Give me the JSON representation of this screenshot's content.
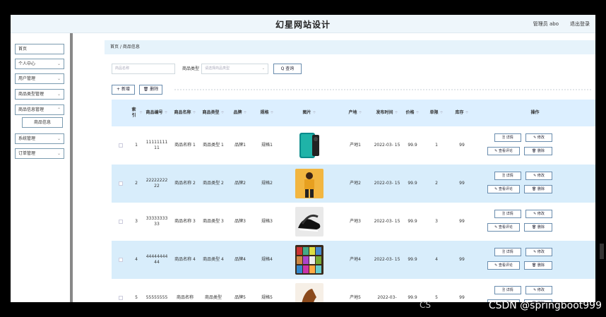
{
  "header": {
    "title": "幻星网站设计",
    "admin": "管理员 abo",
    "logout": "退出登录"
  },
  "sidebar": {
    "items": [
      {
        "label": "首页",
        "expandable": false
      },
      {
        "label": "个人中心",
        "expandable": true
      },
      {
        "label": "用户管理",
        "expandable": true
      },
      {
        "label": "商品类型管理",
        "expandable": true
      },
      {
        "label": "商品信息管理",
        "expandable": true
      },
      {
        "label": "商品信息",
        "expandable": false,
        "sub": true
      },
      {
        "label": "系统管理",
        "expandable": true
      },
      {
        "label": "订单管理",
        "expandable": true
      }
    ]
  },
  "breadcrumb": {
    "home": "首页",
    "sep": "/",
    "current": "商品信息"
  },
  "search": {
    "name_placeholder": "商品名称",
    "type_label": "商品类型",
    "type_placeholder": "请选择商品类型",
    "query_label": "Q 查询"
  },
  "actions": {
    "add_label": "+ 新增",
    "delete_label": "🗑 删除"
  },
  "table": {
    "headers": [
      "索引",
      "商品编号",
      "商品名称",
      "商品类型",
      "品牌",
      "规格",
      "图片",
      "产地",
      "发布时间",
      "价格",
      "单限",
      "库存",
      "操作"
    ],
    "rows": [
      {
        "idx": "1",
        "code": "11111111 11",
        "name": "商品名称 1",
        "type": "商品类型 1",
        "brand": "品牌1",
        "spec": "规格1",
        "origin": "产地1",
        "date": "2022-03- 15",
        "price": "99.9",
        "limit": "1",
        "stock": "99",
        "image": "phone"
      },
      {
        "idx": "2",
        "code": "22222222 22",
        "name": "商品名称 2",
        "type": "商品类型 2",
        "brand": "品牌2",
        "spec": "规格2",
        "origin": "产地2",
        "date": "2022-03- 15",
        "price": "99.9",
        "limit": "2",
        "stock": "99",
        "image": "fashion"
      },
      {
        "idx": "3",
        "code": "33333333 33",
        "name": "商品名称 3",
        "type": "商品类型 3",
        "brand": "品牌3",
        "spec": "规格3",
        "origin": "产地3",
        "date": "2022-03- 15",
        "price": "99.9",
        "limit": "3",
        "stock": "99",
        "image": "shoes"
      },
      {
        "idx": "4",
        "code": "44444444 44",
        "name": "商品名称 4",
        "type": "商品类型 4",
        "brand": "品牌4",
        "spec": "规格4",
        "origin": "产地4",
        "date": "2022-03- 15",
        "price": "99.9",
        "limit": "4",
        "stock": "99",
        "image": "books"
      },
      {
        "idx": "5",
        "code": "55555555",
        "name": "商品名称",
        "type": "商品类型",
        "brand": "品牌5",
        "spec": "规格5",
        "origin": "产地5",
        "date": "2022-03-",
        "price": "99.9",
        "limit": "5",
        "stock": "99",
        "image": "boots"
      }
    ],
    "op_labels": {
      "detail": "详情",
      "edit": "修改",
      "review": "查看评论",
      "delete": "删除"
    }
  },
  "watermark": "CSDN @springboot999",
  "cs_mark": "CS",
  "colors": {
    "accent": "#dcefff",
    "row_alt": "#d8edfb",
    "border": "#6a8dae"
  }
}
